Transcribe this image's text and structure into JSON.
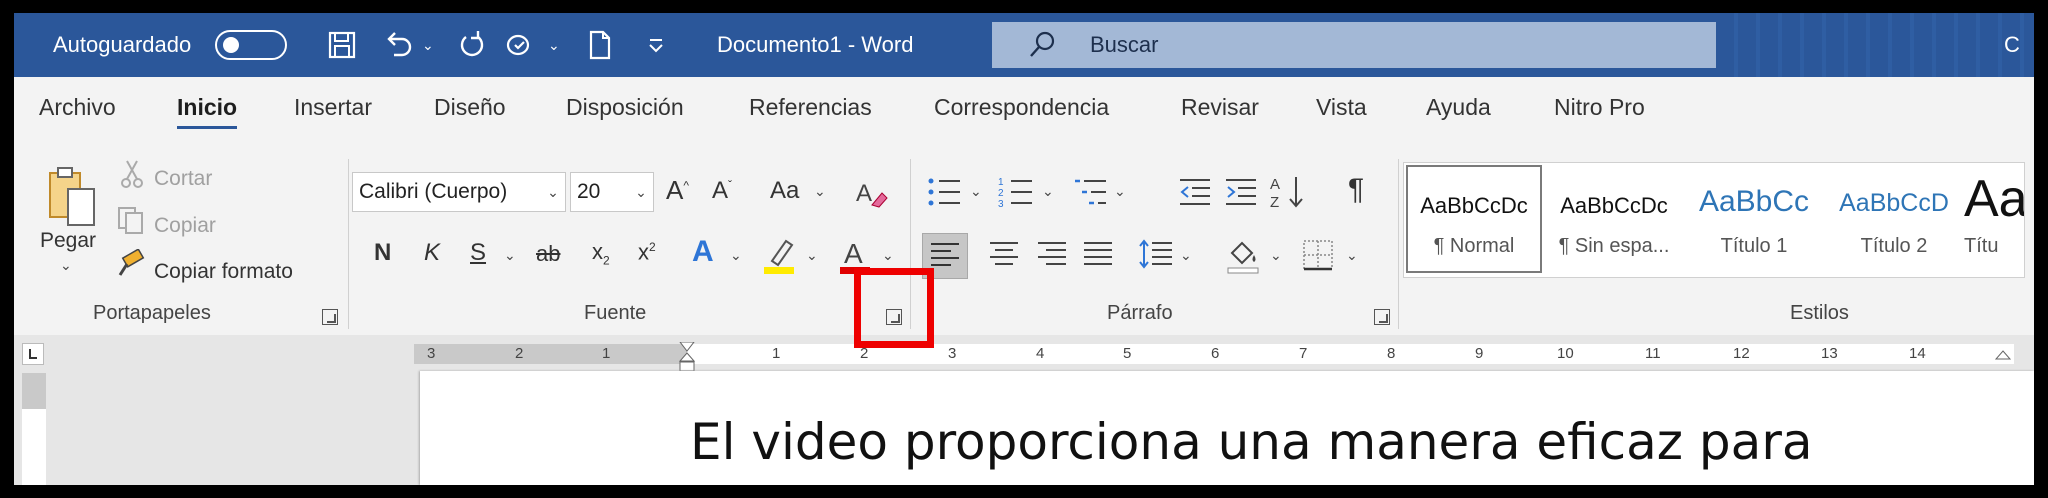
{
  "titlebar": {
    "autosave_label": "Autoguardado",
    "doc_title": "Documento1  -  Word",
    "search_placeholder": "Buscar",
    "user_initial": "C"
  },
  "tabs": [
    {
      "label": "Archivo"
    },
    {
      "label": "Inicio",
      "active": true
    },
    {
      "label": "Insertar"
    },
    {
      "label": "Diseño"
    },
    {
      "label": "Disposición"
    },
    {
      "label": "Referencias"
    },
    {
      "label": "Correspondencia"
    },
    {
      "label": "Revisar"
    },
    {
      "label": "Vista"
    },
    {
      "label": "Ayuda"
    },
    {
      "label": "Nitro Pro"
    }
  ],
  "clipboard": {
    "paste": "Pegar",
    "cut": "Cortar",
    "copy": "Copiar",
    "format_painter": "Copiar formato",
    "group_label": "Portapapeles"
  },
  "font": {
    "font_name": "Calibri (Cuerpo)",
    "font_size": "20",
    "group_label": "Fuente",
    "grow": "A",
    "shrink": "A",
    "case": "Aa",
    "bold": "N",
    "italic": "K",
    "underline": "S",
    "strike": "ab",
    "subscript": "x",
    "superscript": "x",
    "text_effects": "A",
    "font_color": "A"
  },
  "paragraph": {
    "group_label": "Párrafo"
  },
  "styles": {
    "group_label": "Estilos",
    "items": [
      {
        "preview": "AaBbCcDc",
        "name": "¶ Normal",
        "selected": true
      },
      {
        "preview": "AaBbCcDc",
        "name": "¶ Sin espa..."
      },
      {
        "preview": "AaBbCc",
        "name": "Título 1"
      },
      {
        "preview": "AaBbCcD",
        "name": "Título 2"
      },
      {
        "preview": "Aa",
        "name": "Títu"
      }
    ]
  },
  "ruler": {
    "left_numbers": [
      "3",
      "2",
      "1"
    ],
    "right_numbers": [
      "1",
      "2",
      "3",
      "4",
      "5",
      "6",
      "7",
      "8",
      "9",
      "10",
      "11",
      "12",
      "13",
      "14"
    ]
  },
  "document": {
    "text": "El video proporciona una manera eficaz para"
  },
  "colors": {
    "titlebar": "#2b579a",
    "highlight": "#ee0000",
    "font_color_bar": "#e00000",
    "highlight_color_bar": "#ffeb00"
  }
}
